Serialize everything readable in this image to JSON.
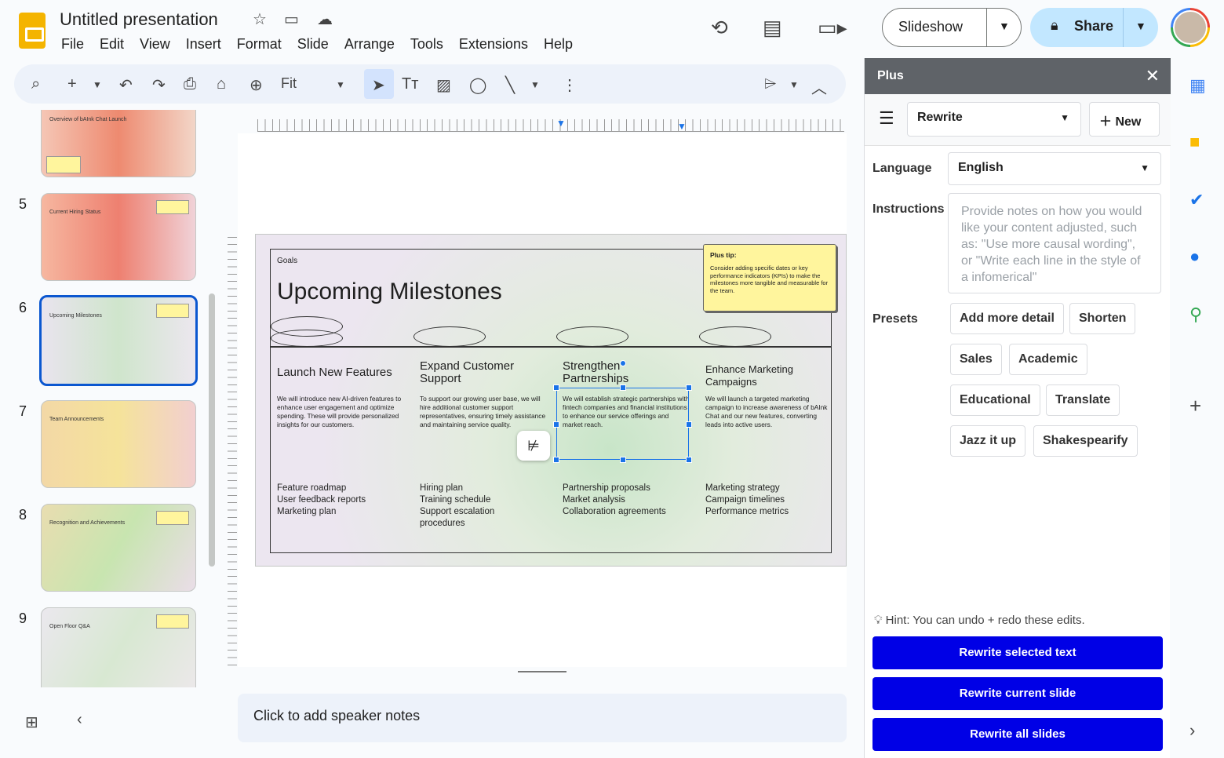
{
  "header": {
    "title": "Untitled presentation",
    "menus": [
      "File",
      "Edit",
      "View",
      "Insert",
      "Format",
      "Slide",
      "Arrange",
      "Tools",
      "Extensions",
      "Help"
    ],
    "slideshow_label": "Slideshow",
    "share_label": "Share"
  },
  "toolbar": {
    "zoom_label": "Fit"
  },
  "filmstrip": {
    "slides": [
      {
        "number": "",
        "title": "Overview of bAInk Chat Launch"
      },
      {
        "number": "5",
        "title": "Current Hiring Status"
      },
      {
        "number": "6",
        "title": "Upcoming Milestones"
      },
      {
        "number": "7",
        "title": "Team Announcements"
      },
      {
        "number": "8",
        "title": "Recognition and Achievements"
      },
      {
        "number": "9",
        "title": "Open Floor Q&A"
      }
    ]
  },
  "slide": {
    "eyebrow": "Goals",
    "heading": "Upcoming Milestones",
    "tip_title": "Plus tip:",
    "tip_body": "Consider adding specific dates or key performance indicators (KPIs) to make the milestones more tangible and measurable for the team.",
    "columns": [
      {
        "title": "Launch New Features",
        "body": "We will introduce new AI-driven features to enhance user engagement and optimize spending. These will provide personalized insights for our customers.",
        "list": "Feature roadmap\nUser feedback reports\nMarketing plan"
      },
      {
        "title": "Expand Customer Support",
        "body": "To support our growing user base, we will hire additional customer support representatives, ensuring timely assistance and maintaining service quality.",
        "list": "Hiring plan\nTraining schedule\nSupport escalation procedures"
      },
      {
        "title": "Strengthen Partnerships",
        "body": "We will establish strategic partnerships with fintech companies and financial institutions to enhance our service offerings and market reach.",
        "list": "Partnership proposals\nMarket analysis\nCollaboration agreements"
      },
      {
        "title": "Enhance Marketing Campaigns",
        "body": "We will launch a targeted marketing campaign to increase awareness of bAInk Chat and our new features, converting leads into active users.",
        "list": "Marketing strategy\nCampaign timelines\nPerformance metrics"
      }
    ]
  },
  "notes": {
    "placeholder": "Click to add speaker notes"
  },
  "panel": {
    "title": "Plus",
    "mode": "Rewrite",
    "new_label": "New",
    "language_label": "Language",
    "language_value": "English",
    "instructions_label": "Instructions",
    "instructions_placeholder": "Provide notes on how you would like your content adjusted, such as: \"Use more causal wording\", or \"Write each line in the style of a infomerical\"",
    "presets_label": "Presets",
    "presets": [
      "Add more detail",
      "Shorten",
      "Sales",
      "Academic",
      "Educational",
      "Translate",
      "Jazz it up",
      "Shakespearify"
    ],
    "hint": "Hint: You can undo + redo these edits.",
    "buttons": [
      "Rewrite selected text",
      "Rewrite current slide",
      "Rewrite all slides"
    ]
  },
  "colors": {
    "accent": "#0b57d0",
    "action_blue": "#0000e6",
    "tip_yellow": "#fff59d"
  }
}
